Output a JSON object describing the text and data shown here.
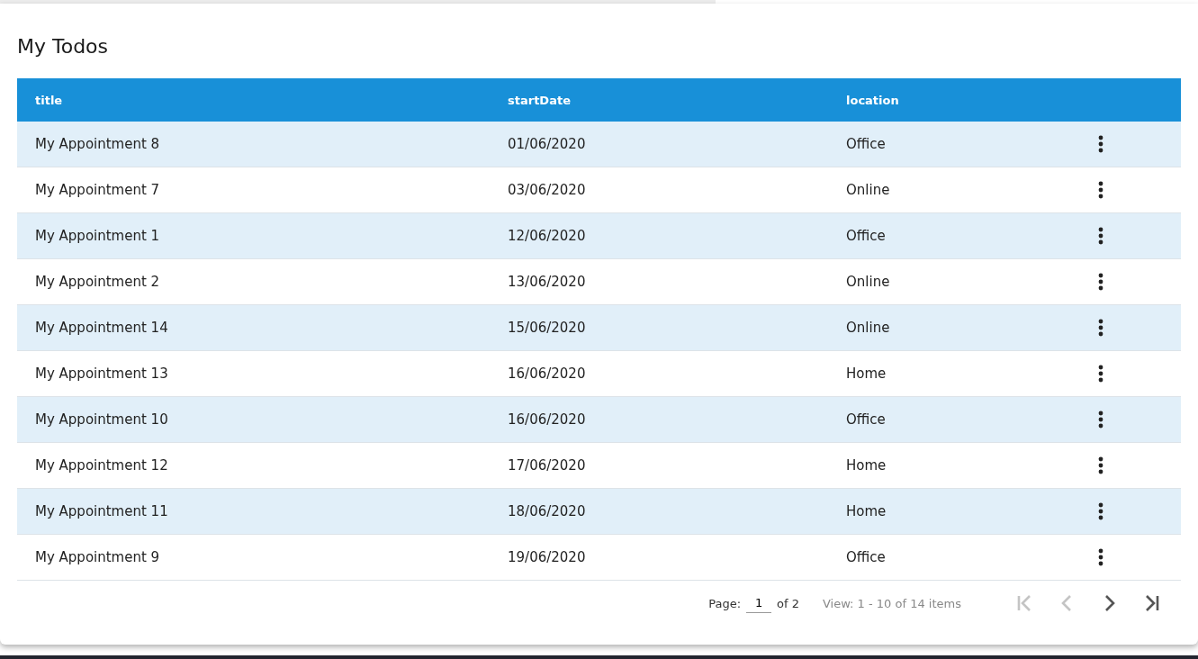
{
  "title": "My Todos",
  "table": {
    "columns": [
      "title",
      "startDate",
      "location"
    ],
    "rows": [
      {
        "title": "My Appointment 8",
        "startDate": "01/06/2020",
        "location": "Office"
      },
      {
        "title": "My Appointment 7",
        "startDate": "03/06/2020",
        "location": "Online"
      },
      {
        "title": "My Appointment 1",
        "startDate": "12/06/2020",
        "location": "Office"
      },
      {
        "title": "My Appointment 2",
        "startDate": "13/06/2020",
        "location": "Online"
      },
      {
        "title": "My Appointment 14",
        "startDate": "15/06/2020",
        "location": "Online"
      },
      {
        "title": "My Appointment 13",
        "startDate": "16/06/2020",
        "location": "Home"
      },
      {
        "title": "My Appointment 10",
        "startDate": "16/06/2020",
        "location": "Office"
      },
      {
        "title": "My Appointment 12",
        "startDate": "17/06/2020",
        "location": "Home"
      },
      {
        "title": "My Appointment 11",
        "startDate": "18/06/2020",
        "location": "Home"
      },
      {
        "title": "My Appointment 9",
        "startDate": "19/06/2020",
        "location": "Office"
      }
    ]
  },
  "pager": {
    "page_label": "Page:",
    "page_value": "1",
    "of_label": "of 2",
    "view_text": "View: 1 - 10 of 14 items",
    "buttons": [
      {
        "kind": "first",
        "disabled": true
      },
      {
        "kind": "prev",
        "disabled": true
      },
      {
        "kind": "next",
        "disabled": false
      },
      {
        "kind": "last",
        "disabled": false
      }
    ]
  }
}
